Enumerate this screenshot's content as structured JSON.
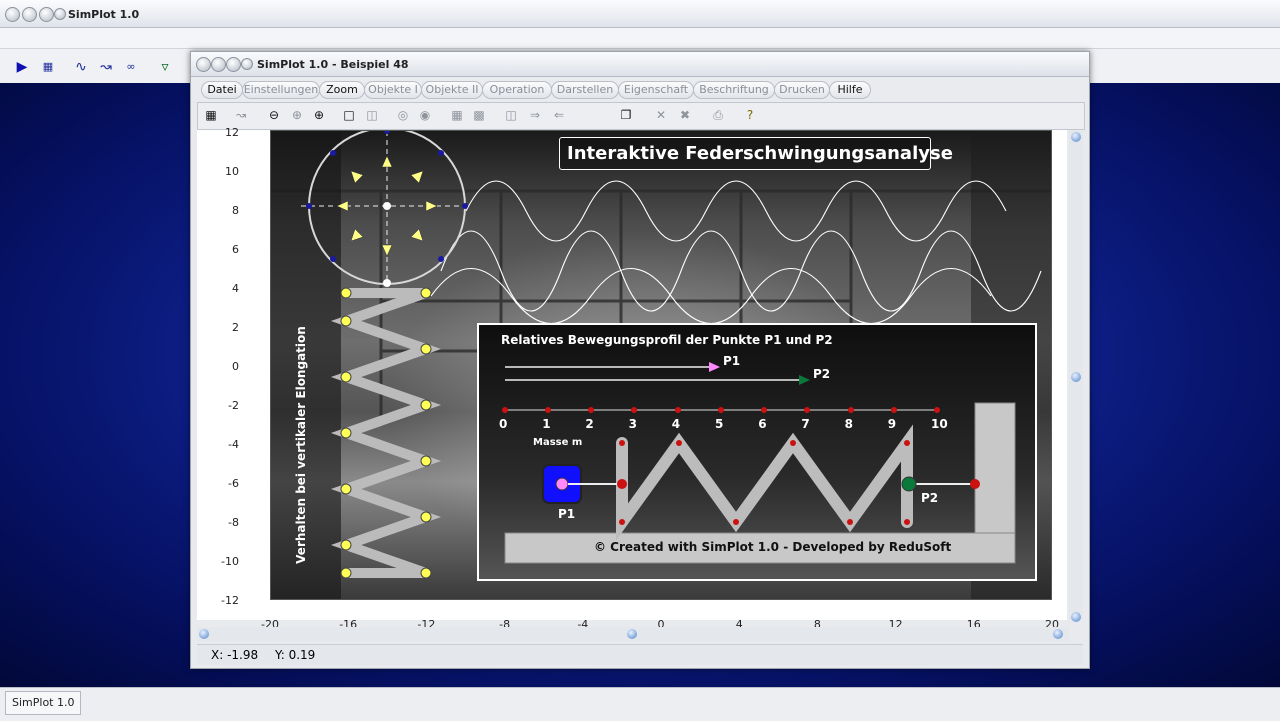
{
  "outer_window": {
    "title": "SimPlot 1.0"
  },
  "inner_window": {
    "title": "SimPlot 1.0 - Beispiel 48"
  },
  "menu": [
    {
      "label": "Datei",
      "enabled": true
    },
    {
      "label": "Einstellungen",
      "enabled": false
    },
    {
      "label": "Zoom",
      "enabled": true
    },
    {
      "label": "Objekte I",
      "enabled": false
    },
    {
      "label": "Objekte II",
      "enabled": false
    },
    {
      "label": "Operation",
      "enabled": false
    },
    {
      "label": "Darstellen",
      "enabled": false
    },
    {
      "label": "Eigenschaft",
      "enabled": false
    },
    {
      "label": "Beschriftung",
      "enabled": false
    },
    {
      "label": "Drucken",
      "enabled": false
    },
    {
      "label": "Hilfe",
      "enabled": true
    }
  ],
  "plot": {
    "y_ticks": [
      "12",
      "10",
      "8",
      "6",
      "4",
      "2",
      "0",
      "-2",
      "-4",
      "-6",
      "-8",
      "-10",
      "-12"
    ],
    "x_ticks": [
      "-20",
      "-16",
      "-12",
      "-8",
      "-4",
      "0",
      "4",
      "8",
      "12",
      "16",
      "20"
    ],
    "title": "Interaktive Federschwingungsanalyse",
    "vertical_label": "Verhalten bei vertikaler Elongation",
    "inset": {
      "heading": "Relatives Bewegungsprofil der Punkte P1 und P2",
      "p1_arrow": "P1",
      "p2_arrow": "P2",
      "scale": [
        "0",
        "1",
        "2",
        "3",
        "4",
        "5",
        "6",
        "7",
        "8",
        "9",
        "10"
      ],
      "mass_label": "Masse m",
      "p1_label": "P1",
      "p2_label": "P2",
      "credit": "© Created with SimPlot 1.0 - Developed by ReduSoft"
    }
  },
  "status": {
    "x": "X: -1.98",
    "y": "Y: 0.19"
  },
  "taskbar": {
    "item": "SimPlot 1.0"
  },
  "colors": {
    "desktop": "#0f2290",
    "mass": "#1010ff",
    "p1": "#ff88ff",
    "p2": "#0a7a3a",
    "red_dot": "#cc1111"
  }
}
